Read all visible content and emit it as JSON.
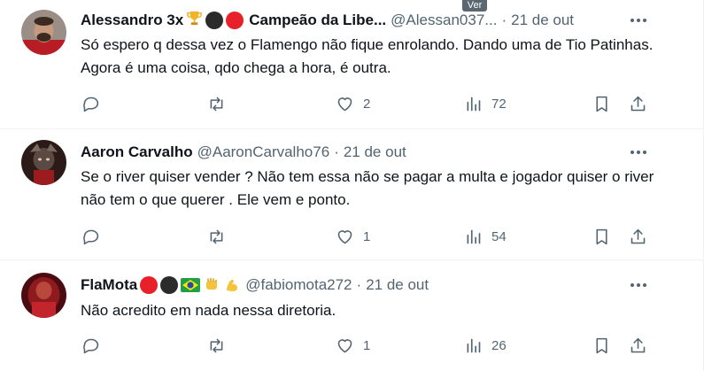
{
  "tooltip": "Ver",
  "tweets": [
    {
      "name": "Alessandro 3x",
      "name_suffix": "Campeão da Libe...",
      "handle": "@Alessan037...",
      "separator": "·",
      "time": "21 de out",
      "text": "Só espero q dessa vez o Flamengo não fique enrolando. Dando uma de Tio Patinhas. Agora é uma coisa, qdo chega a hora, é outra.",
      "likes": "2",
      "views": "72"
    },
    {
      "name": "Aaron Carvalho",
      "handle": "@AaronCarvalho76",
      "separator": "·",
      "time": "21 de out",
      "text": "Se o river quiser vender ? Não tem essa não se pagar a multa e jogador quiser o river não tem o que querer . Ele vem e ponto.",
      "likes": "1",
      "views": "54"
    },
    {
      "name": "FlaMota",
      "handle": "@fabiomota272",
      "separator": "·",
      "time": "21 de out",
      "text": "Não acredito em nada nessa diretoria.",
      "likes": "1",
      "views": "26"
    }
  ],
  "colors": {
    "text": "#0f1419",
    "muted": "#536471",
    "border": "#eff3f4",
    "flamengo_red": "#e8202a",
    "black": "#1d1d1d"
  },
  "icons": [
    "reply-icon",
    "retweet-icon",
    "like-icon",
    "views-icon",
    "bookmark-icon",
    "share-icon",
    "more-icon"
  ]
}
